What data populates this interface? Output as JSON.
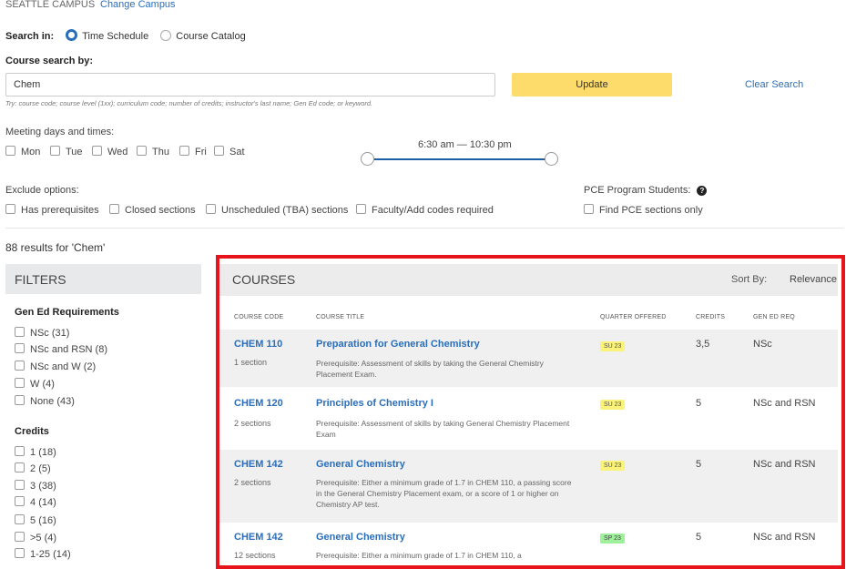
{
  "campus": {
    "name": "SEATTLE CAMPUS",
    "change_label": "Change Campus"
  },
  "search_in": {
    "label": "Search in:",
    "options": [
      "Time Schedule",
      "Course Catalog"
    ],
    "selected": "Time Schedule"
  },
  "course_search": {
    "label": "Course search by:",
    "value": "Chem",
    "hint": "Try: course code; course level (1xx); curriculum code; number of credits; instructor's last name; Gen Ed code; or keyword.",
    "update_label": "Update",
    "clear_label": "Clear Search"
  },
  "meeting": {
    "label": "Meeting days and times:",
    "days": [
      "Mon",
      "Tue",
      "Wed",
      "Thu",
      "Fri",
      "Sat"
    ],
    "time_range": "6:30 am — 10:30 pm"
  },
  "exclude": {
    "label": "Exclude options:",
    "options": [
      "Has prerequisites",
      "Closed sections",
      "Unscheduled (TBA) sections",
      "Faculty/Add codes required"
    ]
  },
  "pce": {
    "label": "PCE Program Students:",
    "option": "Find PCE sections only"
  },
  "results_text": "88 results for 'Chem'",
  "filters": {
    "title": "FILTERS",
    "gen_ed": {
      "title": "Gen Ed Requirements",
      "items": [
        {
          "label": "NSc",
          "count": "(31)"
        },
        {
          "label": "NSc and RSN",
          "count": "(8)"
        },
        {
          "label": "NSc and W",
          "count": "(2)"
        },
        {
          "label": "W",
          "count": "(4)"
        },
        {
          "label": "None",
          "count": "(43)"
        }
      ]
    },
    "credits": {
      "title": "Credits",
      "items": [
        {
          "label": "1",
          "count": "(18)"
        },
        {
          "label": "2",
          "count": "(5)"
        },
        {
          "label": "3",
          "count": "(38)"
        },
        {
          "label": "4",
          "count": "(14)"
        },
        {
          "label": "5",
          "count": "(16)"
        },
        {
          "label": ">5",
          "count": "(4)"
        },
        {
          "label": "1-25",
          "count": "(14)"
        }
      ]
    }
  },
  "courses": {
    "title": "COURSES",
    "sort_label": "Sort By:",
    "sort_value": "Relevance",
    "headers": [
      "COURSE CODE",
      "COURSE TITLE",
      "QUARTER OFFERED",
      "CREDITS",
      "GEN ED REQ"
    ],
    "rows": [
      {
        "code": "CHEM 110",
        "sections": "1 section",
        "title": "Preparation for General Chemistry",
        "prereq": "Prerequisite: Assessment of skills by taking the General Chemistry Placement Exam.",
        "quarter": "SU 23",
        "credits": "3,5",
        "gen_ed": "NSc"
      },
      {
        "code": "CHEM 120",
        "sections": "2 sections",
        "title": "Principles of Chemistry I",
        "prereq": "Prerequisite: Assessment of skills by taking General Chemistry Placement Exam",
        "quarter": "SU 23",
        "credits": "5",
        "gen_ed": "NSc and RSN"
      },
      {
        "code": "CHEM 142",
        "sections": "2 sections",
        "title": "General Chemistry",
        "prereq": "Prerequisite: Either a minimum grade of 1.7 in CHEM 110, a passing score in the General Chemistry Placement exam, or a score of 1 or higher on Chemistry AP test.",
        "quarter": "SU 23",
        "credits": "5",
        "gen_ed": "NSc and RSN"
      },
      {
        "code": "CHEM 142",
        "sections": "12 sections",
        "title": "General Chemistry",
        "prereq": "Prerequisite: Either a minimum grade of 1.7 in CHEM 110, a",
        "quarter": "SP 23",
        "credits": "5",
        "gen_ed": "NSc and RSN"
      }
    ]
  },
  "colors": {
    "accent": "#2a6ebb",
    "update_button": "#fddc6c",
    "highlight": "#e8141c",
    "su_badge": "#fbf27a",
    "sp_badge": "#9ef09a"
  }
}
